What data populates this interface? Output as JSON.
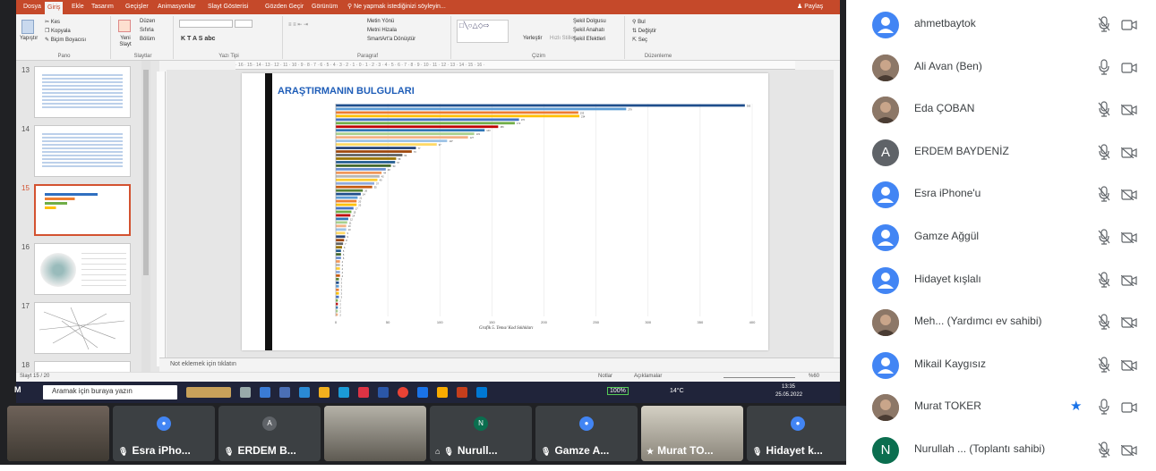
{
  "ribbon": {
    "tabs": [
      "Dosya",
      "Giriş",
      "Ekle",
      "Tasarım",
      "Geçişler",
      "Animasyonlar",
      "Slayt Gösterisi",
      "Gözden Geçir",
      "Görünüm",
      "Ne yapmak istediğinizi söyleyin..."
    ],
    "share": "Paylaş",
    "groups": [
      "Pano",
      "Slaytlar",
      "Yazı Tipi",
      "Paragraf",
      "Çizim",
      "Düzenleme"
    ],
    "pano": {
      "paste": "Yapıştır",
      "cut": "Kes",
      "copy": "Kopyala",
      "format": "Biçim Boyacısı"
    },
    "slides": {
      "new": "Yeni Slayt",
      "layout": "Düzen",
      "reset": "Sıfırla",
      "section": "Bölüm"
    },
    "para": {
      "dir": "Metin Yönü",
      "align": "Metni Hizala",
      "smartart": "SmartArt'a Dönüştür"
    },
    "draw": {
      "arrange": "Yerleştir",
      "quick": "Hızlı Stiller",
      "fill": "Şekil Dolgusu",
      "outline": "Şekil Anahatı",
      "effects": "Şekil Efektleri"
    },
    "edit": {
      "find": "Bul",
      "replace": "Değiştir",
      "select": "Seç"
    }
  },
  "thumbs": [
    "13",
    "14",
    "15",
    "16",
    "17",
    "18"
  ],
  "ruler_h": "· 16 · 15 · 14 · 13 · 12 · 11 · 10 · 9 · 8 · 7 · 6 · 5 · 4 · 3 · 2 · 1 · 0 · 1 · 2 · 3 · 4 · 5 · 6 · 7 · 8 · 9 · 10 · 11 · 12 · 13 · 14 · 15 · 16 ·",
  "slide": {
    "title": "ARAŞTIRMANIN BULGULARI",
    "caption": "Grafik 5. Tema/ Kod Sıklıkları"
  },
  "chart_data": {
    "type": "bar",
    "orientation": "horizontal",
    "xlim": [
      0,
      400
    ],
    "xticks": [
      0,
      50,
      100,
      150,
      200,
      250,
      300,
      350,
      400
    ],
    "values": [
      393,
      279,
      233,
      234,
      176,
      172,
      156,
      143,
      133,
      127,
      107,
      97,
      77,
      73,
      64,
      58,
      57,
      53,
      48,
      44,
      42,
      40,
      37,
      35,
      26,
      24,
      21,
      20,
      20,
      17,
      15,
      14,
      12,
      11,
      10,
      10,
      9,
      9,
      8,
      7,
      6,
      5,
      5,
      5,
      4,
      4,
      4,
      4,
      4,
      3,
      3,
      3,
      3,
      3,
      3,
      2,
      2,
      2,
      2,
      2
    ],
    "colors": [
      "#1f4e8c",
      "#5b9bd5",
      "#ed7d31",
      "#ffc000",
      "#4472c4",
      "#70ad47",
      "#c00000",
      "#2e75b6",
      "#a9d18e",
      "#f4b183",
      "#9dc3e6",
      "#ffd966",
      "#264478",
      "#9e480e",
      "#636363",
      "#997300",
      "#255e91",
      "#43682b",
      "#698ed0",
      "#f1975a",
      "#b7b7b7",
      "#ffcd33",
      "#8faadc",
      "#c55a11",
      "#548235"
    ]
  },
  "notes": "Not eklemek için tıklatın",
  "status": {
    "slide": "Slayt 15 / 20",
    "notes": "Notlar",
    "comments": "Açıklamalar",
    "zoom": "%60"
  },
  "taskbar": {
    "search": "Aramak için buraya yazın",
    "weather": "14°C",
    "time": "13:35",
    "date": "25.05.2022",
    "battery": "100%"
  },
  "strip": {
    "presenter": "M",
    "tiles": [
      {
        "name": "",
        "kind": "video"
      },
      {
        "name": "Esra iPho...",
        "kind": "avatar",
        "letter": "",
        "color": "#4285f4"
      },
      {
        "name": "ERDEM B...",
        "kind": "avatar",
        "letter": "A",
        "color": "#5f6368"
      },
      {
        "name": "",
        "kind": "video"
      },
      {
        "name": "Nurull...",
        "kind": "avatar",
        "letter": "N",
        "color": "#0b6e4f"
      },
      {
        "name": "Gamze A...",
        "kind": "avatar",
        "letter": "",
        "color": "#4285f4"
      },
      {
        "name": "Murat TO...",
        "kind": "video"
      },
      {
        "name": "Hidayet k...",
        "kind": "avatar",
        "letter": "",
        "color": "#4285f4"
      }
    ]
  },
  "participants": [
    {
      "name": "ahmetbaytok",
      "avatar": "icon",
      "mic": "muted",
      "cam": "on"
    },
    {
      "name": "Ali Avan (Ben)",
      "avatar": "photo",
      "mic": "on",
      "cam": "on"
    },
    {
      "name": "Eda ÇOBAN",
      "avatar": "photo",
      "mic": "muted",
      "cam": "off"
    },
    {
      "name": "ERDEM BAYDENİZ",
      "avatar": "letter",
      "letter": "A",
      "color": "#5f6368",
      "mic": "muted",
      "cam": "off"
    },
    {
      "name": "Esra iPhone'u",
      "avatar": "icon",
      "mic": "muted",
      "cam": "off"
    },
    {
      "name": "Gamze Ağgül",
      "avatar": "icon",
      "mic": "muted",
      "cam": "off"
    },
    {
      "name": "Hidayet kışlalı",
      "avatar": "icon",
      "mic": "muted",
      "cam": "off"
    },
    {
      "name": "Meh...   (Yardımcı ev sahibi)",
      "avatar": "photo",
      "mic": "muted",
      "cam": "off"
    },
    {
      "name": "Mikail Kaygısız",
      "avatar": "icon",
      "mic": "muted",
      "cam": "off"
    },
    {
      "name": "Murat TOKER",
      "avatar": "photo",
      "mic": "on",
      "cam": "on",
      "pinned": true
    },
    {
      "name": "Nurullah ...  (Toplantı sahibi)",
      "avatar": "letter",
      "letter": "N",
      "color": "#0b6e4f",
      "mic": "muted",
      "cam": "off"
    }
  ]
}
